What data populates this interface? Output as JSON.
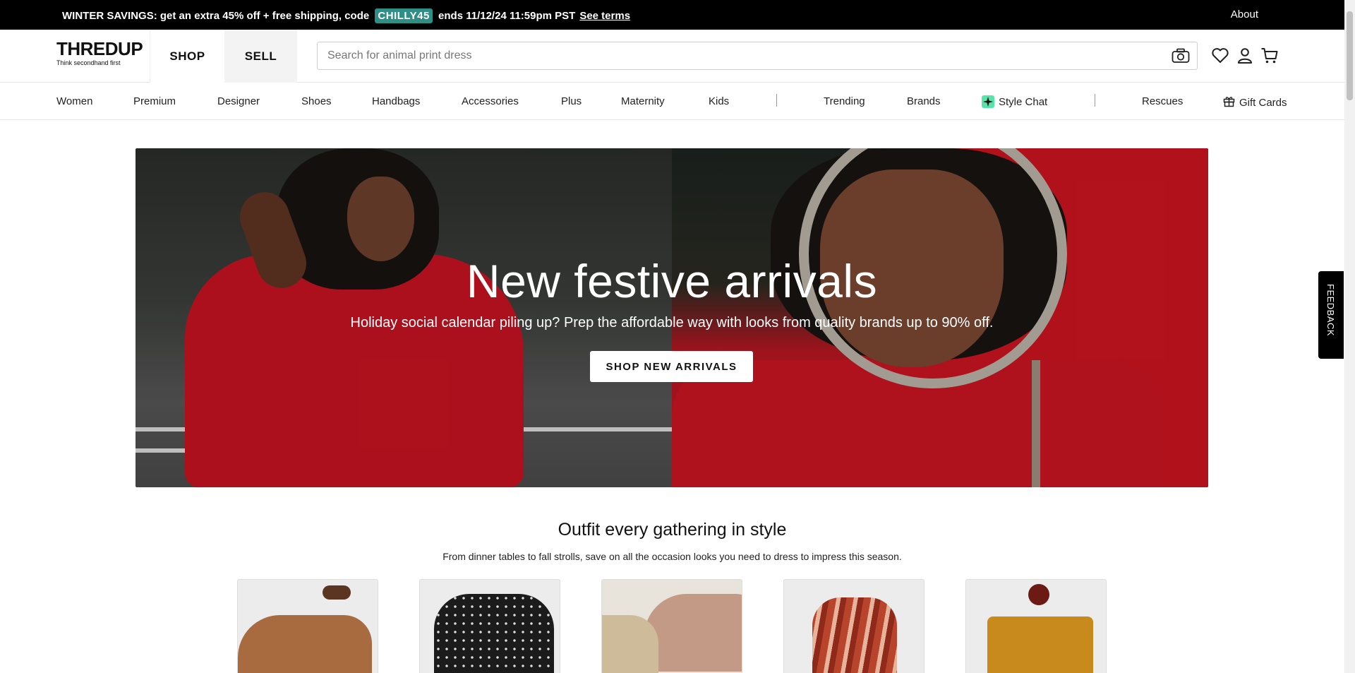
{
  "promo": {
    "text_before": "WINTER SAVINGS: get an extra 45% off + free shipping, code ",
    "code": "CHILLY45",
    "text_after": " ends 11/12/24 11:59pm PST",
    "link": "See terms",
    "about": "About"
  },
  "header": {
    "logo": "THREDUP",
    "tagline": "Think secondhand first",
    "tab_shop": "SHOP",
    "tab_sell": "SELL",
    "search_placeholder": "Search for animal print dress"
  },
  "nav": {
    "women": "Women",
    "premium": "Premium",
    "designer": "Designer",
    "shoes": "Shoes",
    "handbags": "Handbags",
    "accessories": "Accessories",
    "plus": "Plus",
    "maternity": "Maternity",
    "kids": "Kids",
    "trending": "Trending",
    "brands": "Brands",
    "style_chat": "Style Chat",
    "rescues": "Rescues",
    "gift_cards": "Gift Cards"
  },
  "hero": {
    "title": "New festive arrivals",
    "subtitle": "Holiday social calendar piling up? Prep the affordable way with looks from quality brands up to 90% off.",
    "button": "SHOP NEW ARRIVALS"
  },
  "section": {
    "title": "Outfit every gathering in style",
    "subtitle": "From dinner tables to fall strolls, save on all the occasion looks you need to dress to impress this season."
  },
  "feedback": "FEEDBACK",
  "colors": {
    "promo_code_bg": "#2f8f86",
    "hero_red": "#c41320",
    "style_chat_accent": "#57e3a9"
  }
}
